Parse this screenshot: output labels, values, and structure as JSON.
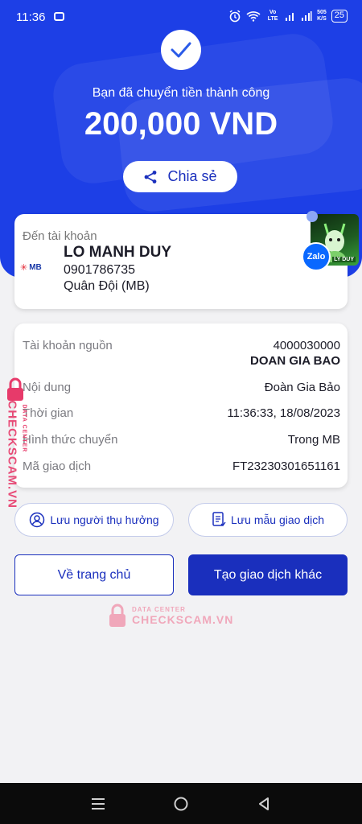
{
  "status_bar": {
    "time": "11:36",
    "network_label": "Vo LTE",
    "speed": "505",
    "speed_unit": "K/S",
    "battery": "25"
  },
  "header": {
    "success_message": "Bạn đã chuyển tiền thành công",
    "amount": "200,000 VND",
    "share_label": "Chia sẻ"
  },
  "recipient": {
    "to_label": "Đến tài khoản",
    "bank_logo": "MB",
    "name": "LO MANH DUY",
    "account": "0901786735",
    "bank": "Quân Đội (MB)",
    "avatar_text": "LY DUY",
    "zalo": "Zalo"
  },
  "details": [
    {
      "label": "Tài khoản nguồn",
      "value": "4000030000",
      "value2": "DOAN GIA BAO"
    },
    {
      "label": "Nội dung",
      "value": "Đoàn Gia Bảo"
    },
    {
      "label": "Thời gian",
      "value": "11:36:33, 18/08/2023"
    },
    {
      "label": "Hình thức chuyển",
      "value": "Trong MB"
    },
    {
      "label": "Mã giao dịch",
      "value": "FT23230301651161"
    }
  ],
  "actions": {
    "save_recipient": "Lưu người thụ hưởng",
    "save_template": "Lưu mẫu giao dịch",
    "home": "Về trang chủ",
    "new_transaction": "Tạo giao dịch khác"
  },
  "watermark": {
    "small": "DATA CENTER",
    "big": "CHECKSCAM.VN"
  },
  "colors": {
    "primary": "#1d3fe6",
    "button": "#1a2fbd",
    "watermark": "#f06a8c"
  }
}
